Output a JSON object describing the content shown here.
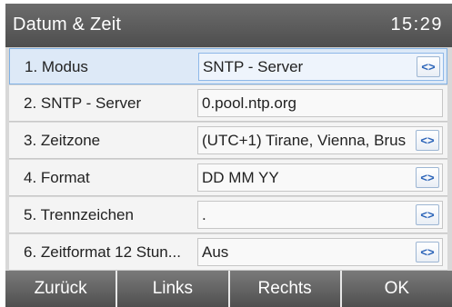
{
  "header": {
    "title": "Datum & Zeit",
    "time": "15:29"
  },
  "icons": {
    "select_arrows": "left-right-arrows-icon"
  },
  "rows": [
    {
      "label": "1. Modus",
      "value": "SNTP - Server",
      "has_arrows": true
    },
    {
      "label": "2. SNTP - Server",
      "value": "0.pool.ntp.org",
      "has_arrows": false
    },
    {
      "label": "3. Zeitzone",
      "value": "(UTC+1) Tirane, Vienna, Brus",
      "has_arrows": true
    },
    {
      "label": "4. Format",
      "value": "DD MM YY",
      "has_arrows": true
    },
    {
      "label": "5. Trennzeichen",
      "value": ".",
      "has_arrows": true
    },
    {
      "label": "6. Zeitformat 12 Stun...",
      "value": "Aus",
      "has_arrows": true
    }
  ],
  "softkeys": {
    "back": "Zurück",
    "left": "Links",
    "right": "Rechts",
    "ok": "OK"
  },
  "arrow_glyph": "<>"
}
